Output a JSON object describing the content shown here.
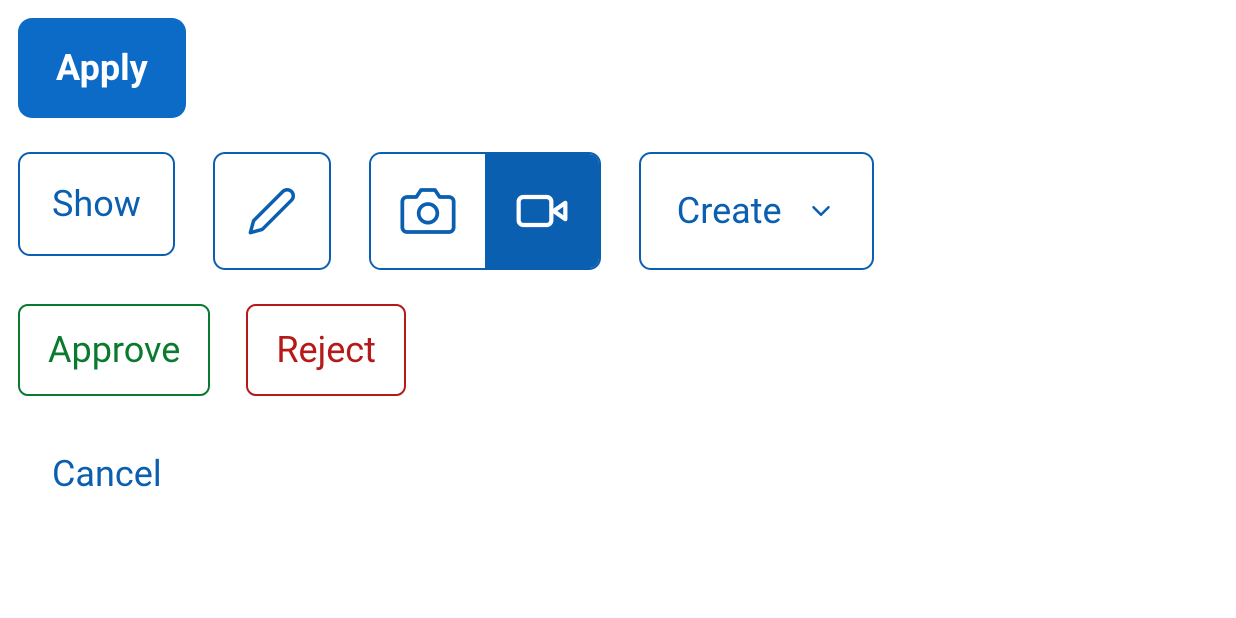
{
  "buttons": {
    "apply": "Apply",
    "show": "Show",
    "create": "Create",
    "approve": "Approve",
    "reject": "Reject",
    "cancel": "Cancel"
  },
  "icons": {
    "pencil": "pencil-icon",
    "camera": "camera-icon",
    "video": "video-icon",
    "chevron": "chevron-down-icon"
  }
}
